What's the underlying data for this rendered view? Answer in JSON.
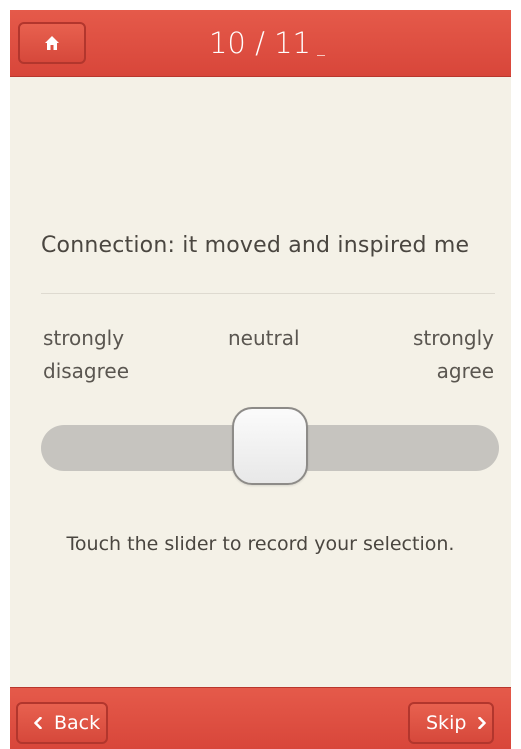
{
  "header": {
    "home_icon": "home-icon",
    "progress": "10 / 11",
    "progress_current": 10,
    "progress_total": 11
  },
  "question": {
    "text": "Connection: it moved and inspired me"
  },
  "scale": {
    "left_label": "strongly disagree",
    "middle_label": "neutral",
    "right_label": "strongly agree",
    "value": 0.5
  },
  "hint": "Touch the slider to record your selection.",
  "footer": {
    "back_label": "Back",
    "back_icon": "chevron-left-icon",
    "skip_label": "Skip",
    "skip_icon": "chevron-right-icon"
  },
  "colors": {
    "accent": "#dd4f41",
    "background": "#f4f1e7",
    "track": "#c6c4bf",
    "text": "#4a4640"
  }
}
